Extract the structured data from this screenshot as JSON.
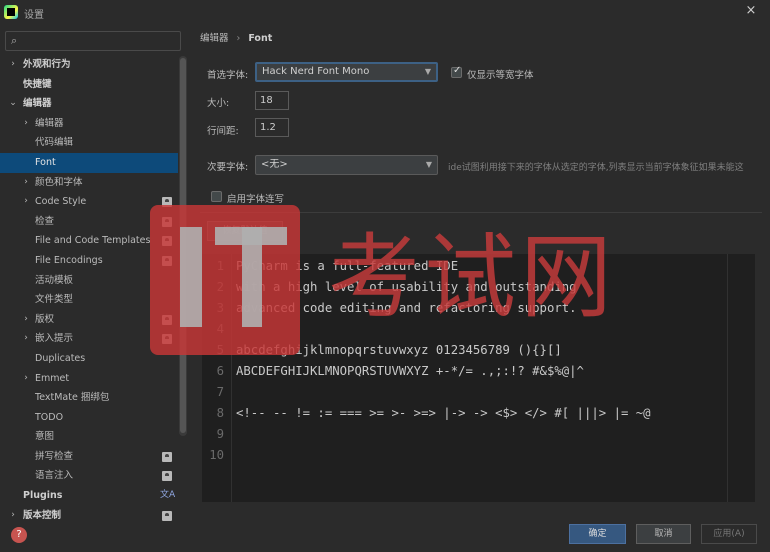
{
  "window": {
    "title": "设置",
    "close_icon": "×"
  },
  "sidebar": {
    "search_placeholder": "",
    "search_icon": "⌕",
    "items": [
      {
        "label": "外观和行为",
        "level": 0,
        "chevron": "›",
        "bold": true
      },
      {
        "label": "快捷键",
        "level": 0,
        "chevron": "",
        "bold": true
      },
      {
        "label": "编辑器",
        "level": 0,
        "chevron": "⌄",
        "bold": true
      },
      {
        "label": "编辑器",
        "level": 1,
        "chevron": "›"
      },
      {
        "label": "代码编辑",
        "level": 1,
        "chevron": ""
      },
      {
        "label": "Font",
        "level": 1,
        "chevron": "",
        "selected": true
      },
      {
        "label": "颜色和字体",
        "level": 1,
        "chevron": "›"
      },
      {
        "label": "Code Style",
        "level": 1,
        "chevron": "›",
        "badge": "project"
      },
      {
        "label": "检查",
        "level": 1,
        "chevron": "",
        "badge": "project"
      },
      {
        "label": "File and Code Templates",
        "level": 1,
        "chevron": "",
        "badge": "project"
      },
      {
        "label": "File Encodings",
        "level": 1,
        "chevron": "",
        "badge": "project"
      },
      {
        "label": "活动模板",
        "level": 1,
        "chevron": ""
      },
      {
        "label": "文件类型",
        "level": 1,
        "chevron": ""
      },
      {
        "label": "版权",
        "level": 1,
        "chevron": "›",
        "badge": "project"
      },
      {
        "label": "嵌入提示",
        "level": 1,
        "chevron": "›",
        "badge": "project"
      },
      {
        "label": "Duplicates",
        "level": 1,
        "chevron": ""
      },
      {
        "label": "Emmet",
        "level": 1,
        "chevron": "›"
      },
      {
        "label": "TextMate 捆绑包",
        "level": 1,
        "chevron": ""
      },
      {
        "label": "TODO",
        "level": 1,
        "chevron": ""
      },
      {
        "label": "意图",
        "level": 1,
        "chevron": ""
      },
      {
        "label": "拼写检查",
        "level": 1,
        "chevron": "",
        "badge": "project"
      },
      {
        "label": "语言注入",
        "level": 1,
        "chevron": "",
        "badge": "project"
      },
      {
        "label": "Plugins",
        "level": 0,
        "chevron": "",
        "bold": true,
        "badge": "language"
      },
      {
        "label": "版本控制",
        "level": 0,
        "chevron": "›",
        "bold": true,
        "badge": "project"
      }
    ],
    "language_badge_glyph": "文A",
    "help_icon": "?"
  },
  "breadcrumb": {
    "parent": "编辑器",
    "separator": "›",
    "current": "Font"
  },
  "font_settings": {
    "primary_font_label": "首选字体:",
    "primary_font_value": "Hack Nerd Font Mono",
    "monospaced_only_label": "仅显示等宽字体",
    "monospaced_only_checked": true,
    "size_label": "大小:",
    "size_value": "18",
    "line_spacing_label": "行间距:",
    "line_spacing_value": "1.2",
    "fallback_font_label": "次要字体:",
    "fallback_font_value": "<无>",
    "fallback_hint": "ide试图利用接下来的字体从选定的字体,列表显示当前字体象征如果未能这",
    "ligatures_label": "启用字体连写",
    "ligatures_checked": false,
    "restore_defaults_label": "恢复默认值"
  },
  "preview": {
    "lines": [
      {
        "n": "1",
        "text": "PyCharm is a full-featured IDE"
      },
      {
        "n": "2",
        "text": "with a high level of usability and outstanding"
      },
      {
        "n": "3",
        "text": "advanced code editing and refactoring support."
      },
      {
        "n": "4",
        "text": ""
      },
      {
        "n": "5",
        "text": "abcdefghijklmnopqrstuvwxyz 0123456789 (){}[]"
      },
      {
        "n": "6",
        "text": "ABCDEFGHIJKLMNOPQRSTUVWXYZ +-*/= .,;:!? #&$%@|^"
      },
      {
        "n": "7",
        "text": ""
      },
      {
        "n": "8",
        "text": "<!-- -- != := === >= >- >=> |-> -> <$> </> #[ |||> |= ~@"
      },
      {
        "n": "9",
        "text": ""
      },
      {
        "n": "10",
        "text": ""
      }
    ]
  },
  "footer": {
    "ok_label": "确定",
    "cancel_label": "取消",
    "apply_label": "应用(A)"
  },
  "watermark": {
    "logo_text": "IT",
    "text": "考试网"
  },
  "colors": {
    "selection": "#0d4a7a",
    "ok_button": "#365880",
    "watermark": "#c83737"
  }
}
